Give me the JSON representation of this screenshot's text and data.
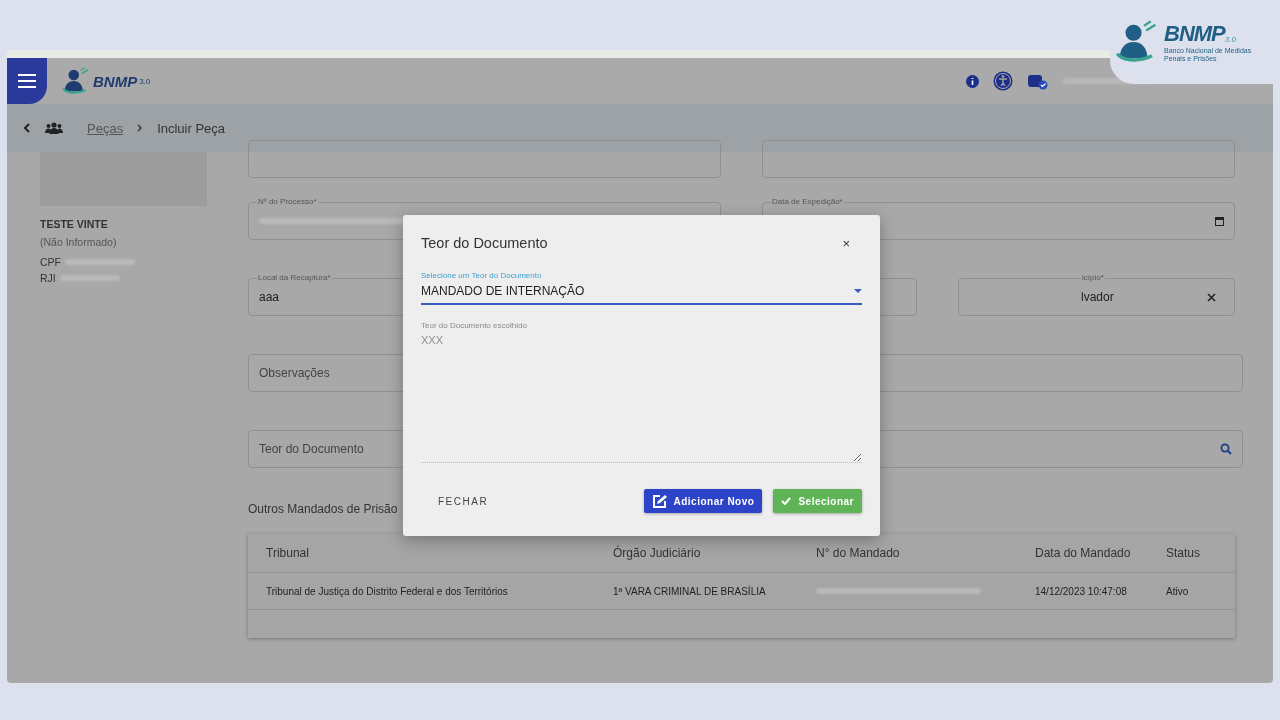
{
  "breadcrumb": {
    "link": "Peças",
    "current": "Incluir Peça"
  },
  "person": {
    "name": "TESTE VINTE",
    "status": "(Não Informado)",
    "ids": [
      {
        "label": "CPF"
      },
      {
        "label": "RJI"
      }
    ]
  },
  "form": {
    "processo": {
      "label": "Nº do Processo*"
    },
    "data_expedicao": {
      "label": "Data de Expedição*"
    },
    "local": {
      "label": "Local da Recaptura*",
      "value": "aaa"
    },
    "municipio": {
      "label": "icípio*",
      "value": "lvador"
    },
    "observacoes": {
      "placeholder": "Observações"
    },
    "teor": {
      "placeholder": "Teor do Documento"
    }
  },
  "section_title": "Outros Mandados de Prisão",
  "table": {
    "columns": [
      "Tribunal",
      "Órgão Judiciário",
      "N° do Mandado",
      "Data do Mandado",
      "Status"
    ],
    "rows": [
      {
        "tribunal": "Tribunal de Justiça do Distrito Federal e dos Territórios",
        "orgao": "1ª VARA CRIMINAL DE BRASÍLIA",
        "data": "14/12/2023 10:47:08",
        "status": "Ativo"
      }
    ]
  },
  "dialog": {
    "title": "Teor do Documento",
    "close": "×",
    "select": {
      "label": "Selecione um Teor do Documento",
      "value": "MANDADO DE INTERNAÇÃO"
    },
    "textarea": {
      "label": "Teor do Documento escolhido",
      "placeholder": "XXX"
    },
    "buttons": [
      {
        "kind": "text",
        "label": "FECHAR"
      },
      {
        "kind": "add",
        "label": "Adicionar Novo"
      },
      {
        "kind": "select",
        "label": "Selecionar"
      }
    ]
  },
  "header_logo": {
    "title": "BNMP",
    "version": "3.0"
  },
  "corner_logo": {
    "title": "BNMP",
    "version": "3.0",
    "subtitle": "Banco Nacional de Medidas Penais e Prisões"
  }
}
